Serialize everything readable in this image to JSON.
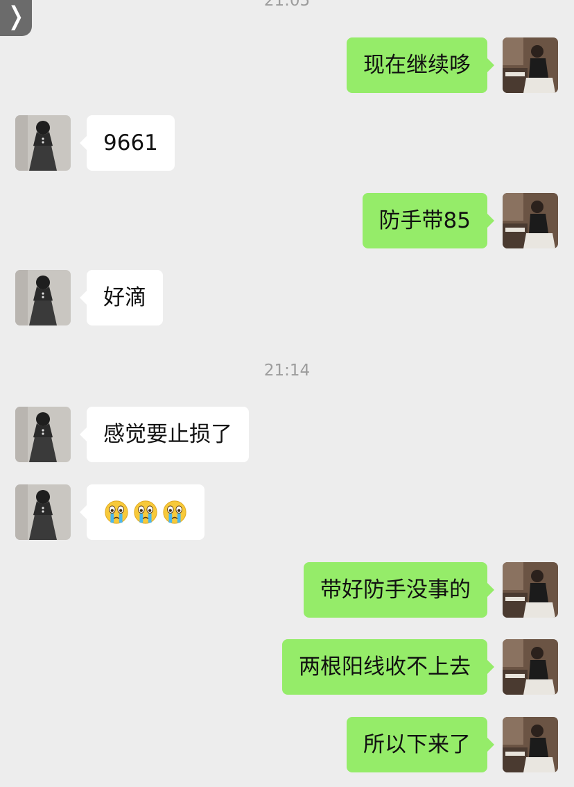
{
  "nav": {
    "back_glyph": "❭"
  },
  "timestamps": {
    "t1": "21:05",
    "t2": "21:14"
  },
  "messages": [
    {
      "side": "right",
      "text": "现在继续哆"
    },
    {
      "side": "left",
      "text": "9661"
    },
    {
      "side": "right",
      "text": "防手带85"
    },
    {
      "side": "left",
      "text": "好滴"
    },
    {
      "side": "left",
      "text": "感觉要止损了"
    },
    {
      "side": "left",
      "emoji": [
        "crying-face",
        "crying-face",
        "crying-face"
      ]
    },
    {
      "side": "right",
      "text": "带好防手没事的"
    },
    {
      "side": "right",
      "text": "两根阳线收不上去"
    },
    {
      "side": "right",
      "text": "所以下来了"
    }
  ],
  "colors": {
    "background": "#ededed",
    "sent_bubble": "#95ec69",
    "received_bubble": "#ffffff",
    "timestamp_text": "#9c9c9c"
  }
}
